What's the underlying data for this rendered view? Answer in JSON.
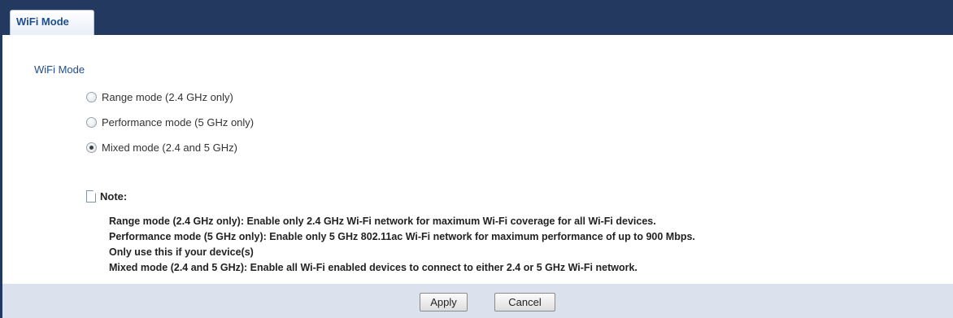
{
  "tab": {
    "label": "WiFi Mode"
  },
  "section": {
    "title": "WiFi Mode"
  },
  "modes": [
    {
      "label": "Range mode (2.4 GHz only)",
      "checked": false
    },
    {
      "label": "Performance mode (5 GHz only)",
      "checked": false
    },
    {
      "label": "Mixed mode (2.4 and 5 GHz)",
      "checked": true
    }
  ],
  "note": {
    "label": "Note:",
    "lines": [
      "Range mode (2.4 GHz only): Enable only 2.4 GHz Wi-Fi network for maximum Wi-Fi coverage for all Wi-Fi devices.",
      "Performance mode (5 GHz only): Enable only 5 GHz 802.11ac Wi-Fi network for maximum performance of up to 900 Mbps.",
      "Only use this if your device(s)",
      "Mixed mode (2.4 and 5 GHz): Enable all Wi-Fi enabled devices to connect to either 2.4 or 5 GHz Wi-Fi network."
    ]
  },
  "buttons": {
    "apply": "Apply",
    "cancel": "Cancel"
  },
  "colors": {
    "header_bg": "#24395f",
    "title_text": "#1d4e8f",
    "footer_bg": "#dbe2ee"
  }
}
